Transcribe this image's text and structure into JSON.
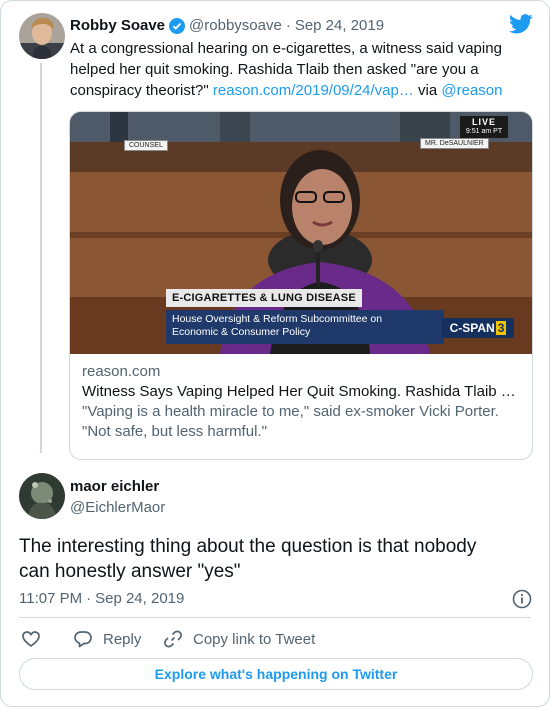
{
  "quoted": {
    "display_name": "Robby Soave",
    "handle": "@robbysoave",
    "separator": "·",
    "date": "Sep 24, 2019",
    "text_line1": "At a congressional hearing on e-cigarettes, a witness said vaping",
    "text_line2": "helped her quit smoking. Rashida Tlaib then asked \"are you a",
    "text_line3_plain": "conspiracy theorist?\" ",
    "text_link": "reason.com/2019/09/24/vap…",
    "via_word": " via ",
    "via_handle": "@reason"
  },
  "card": {
    "live_label": "LIVE",
    "live_time": "9:51 am PT",
    "nameplate_left": "COUNSEL",
    "nameplate_right": "MR. DeSAULNIER",
    "chyron_title": "E-CIGARETTES & LUNG DISEASE",
    "chyron_sub_line1": "House Oversight & Reform Subcommittee on",
    "chyron_sub_line2": "Economic & Consumer Policy",
    "network": "C-SPAN",
    "network_number": "3",
    "domain": "reason.com",
    "title": "Witness Says Vaping Helped Her Quit Smoking. Rashida Tlaib …",
    "desc_line1": "\"Vaping is a health miracle to me,\" said ex-smoker Vicki Porter.",
    "desc_line2": "\"Not safe, but less harmful.\""
  },
  "reply": {
    "display_name": "maor eichler",
    "handle": "@EichlerMaor",
    "text_line1": "The interesting thing about the question is that nobody",
    "text_line2": "can honestly answer \"yes\"",
    "time": "11:07 PM",
    "separator": "·",
    "date": "Sep 24, 2019"
  },
  "actions": {
    "reply_label": "Reply",
    "copy_label": "Copy link to Tweet"
  },
  "explore_label": "Explore what's happening on Twitter",
  "colors": {
    "accent": "#1d9bf0",
    "text": "#0f1419",
    "muted": "#536471",
    "border": "#cfd9de"
  }
}
